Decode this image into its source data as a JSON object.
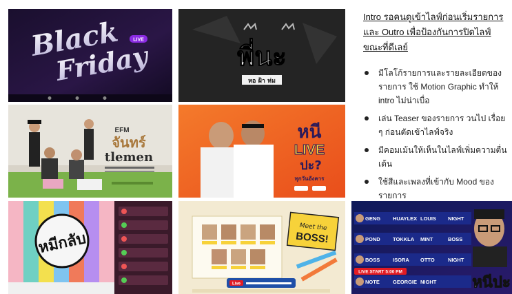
{
  "panel": {
    "heading": "Intro รอคนดูเข้าไลฟ์ก่อนเริ่มรายการ และ Outro เพื่อป้องกันการปิดไลฟ์ ขณะที่ดีเลย์",
    "bullets": [
      "มีโลโก้รายการและรายละเอียดของ รายการ ใช้ Motion Graphic ทำให้ intro ไม่น่าเบื่อ",
      "เล่น Teaser ของรายการ วนไป เรื่อย ๆ ก่อนตัดเข้าไลฟ์จริง",
      "มีคอมเม้นให้เห็นในไลฟ์เพิ่มความตื่นเต้น",
      "ใช้สีและเพลงที่เข้ากับ Mood ของ รายการ"
    ]
  },
  "tiles": {
    "black_friday": {
      "title_1": "Black",
      "title_2": "Friday",
      "badge": "LIVE"
    },
    "mor_namhom": {
      "logo": "พี่นะ",
      "sub": "หอ ฝ้า ห่ม"
    },
    "efm": {
      "brand": "EFM",
      "title_th": "จันทร์",
      "title_en": "tlemen"
    },
    "nimi_live": {
      "line1": "หนี",
      "line2": "LIVE",
      "line3": "ปะ?",
      "schedule": "ทุกวันอังคาร"
    },
    "color_bars": {
      "logo": "หมีกลับ"
    },
    "meet_boss": {
      "title": "Meet the",
      "title2": "BOSS!",
      "footer": "Live"
    },
    "match": {
      "names_left": [
        "GENG",
        "POND",
        "BOSS",
        "NOTE"
      ],
      "names_mid": [
        "HUAYLEX",
        "TOKKLA",
        "ISORA",
        "GEORGIE"
      ],
      "names_right": [
        "LOUIS",
        "MINT",
        "OTTO",
        "NIGHT"
      ],
      "names_far": [
        "NIGHT",
        "BOSS",
        "NIGHT"
      ],
      "start": "LIVE START 5:00 PM",
      "logo": "หนีปะ"
    }
  },
  "colors": {
    "panel_text": "#111111",
    "live_red": "#e31b23",
    "boss_yellow": "#f7d23a",
    "match_blue": "#1b2a8a"
  }
}
